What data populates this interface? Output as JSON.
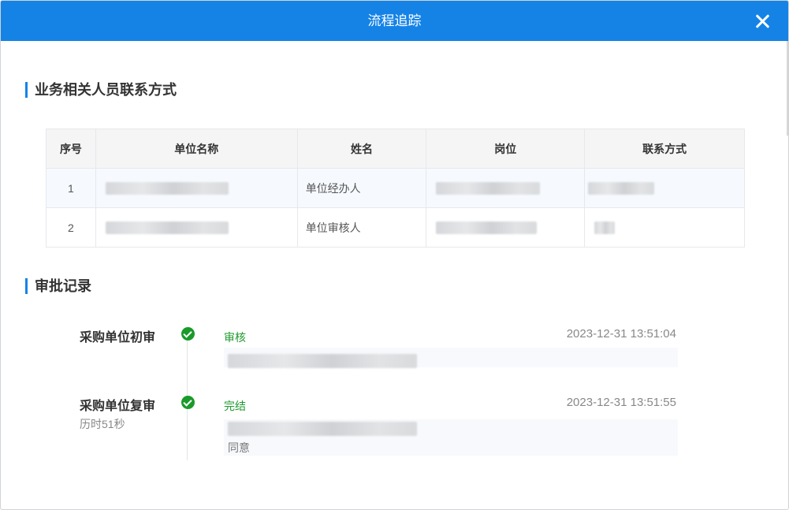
{
  "dialog": {
    "title": "流程追踪"
  },
  "contacts": {
    "section_title": "业务相关人员联系方式",
    "headers": [
      "序号",
      "单位名称",
      "姓名",
      "岗位",
      "联系方式"
    ],
    "rows": [
      {
        "index": "1",
        "name": "单位经办人"
      },
      {
        "index": "2",
        "name": "单位审核人"
      }
    ]
  },
  "approval": {
    "section_title": "审批记录",
    "records": [
      {
        "step": "采购单位初审",
        "elapsed": "",
        "status": "审核",
        "time": "2023-12-31 13:51:04",
        "comment": ""
      },
      {
        "step": "采购单位复审",
        "elapsed": "历时51秒",
        "status": "完结",
        "time": "2023-12-31 13:51:55",
        "comment": "同意"
      }
    ]
  },
  "colors": {
    "header_blue": "#1583e6",
    "success_green": "#1a9a2a",
    "row_highlight": "#f6faff"
  },
  "icons": {
    "close": "close-icon",
    "check": "check-circle-icon"
  }
}
